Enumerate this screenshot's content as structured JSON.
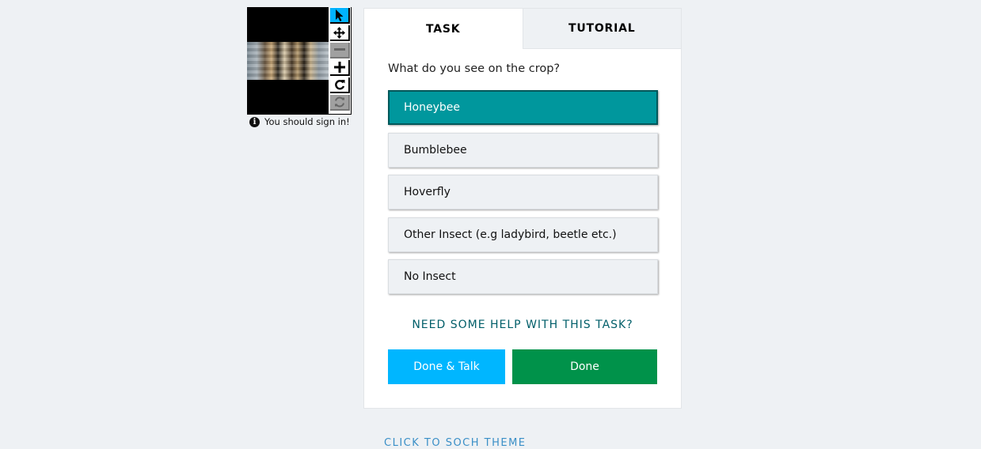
{
  "viewer": {
    "tools": [
      {
        "name": "select-arrow-icon",
        "state": "active"
      },
      {
        "name": "move-icon",
        "state": "normal"
      },
      {
        "name": "zoom-out-icon",
        "state": "disabled"
      },
      {
        "name": "zoom-in-icon",
        "state": "normal"
      },
      {
        "name": "rotate-icon",
        "state": "normal"
      },
      {
        "name": "reset-icon",
        "state": "disabled"
      }
    ],
    "signin_text": "You should sign in!"
  },
  "tabs": [
    {
      "label": "TASK",
      "active": true
    },
    {
      "label": "TUTORIAL",
      "active": false
    }
  ],
  "task": {
    "question": "What do you see on the crop?",
    "answers": [
      {
        "label": "Honeybee",
        "selected": true
      },
      {
        "label": "Bumblebee",
        "selected": false
      },
      {
        "label": "Hoverfly",
        "selected": false
      },
      {
        "label": "Other Insect (e.g ladybird, beetle etc.)",
        "selected": false
      },
      {
        "label": "No Insect",
        "selected": false
      }
    ],
    "help_link": "NEED SOME HELP WITH THIS TASK?",
    "done_talk_label": "Done & Talk",
    "done_label": "Done"
  },
  "footer": {
    "link_text": "CLICK TO SOCH THEME"
  },
  "colors": {
    "selected_answer": "#00979d",
    "done_talk": "#00b6ff",
    "done": "#00924a",
    "active_tool": "#00b3ff",
    "help_link": "#005e69"
  }
}
